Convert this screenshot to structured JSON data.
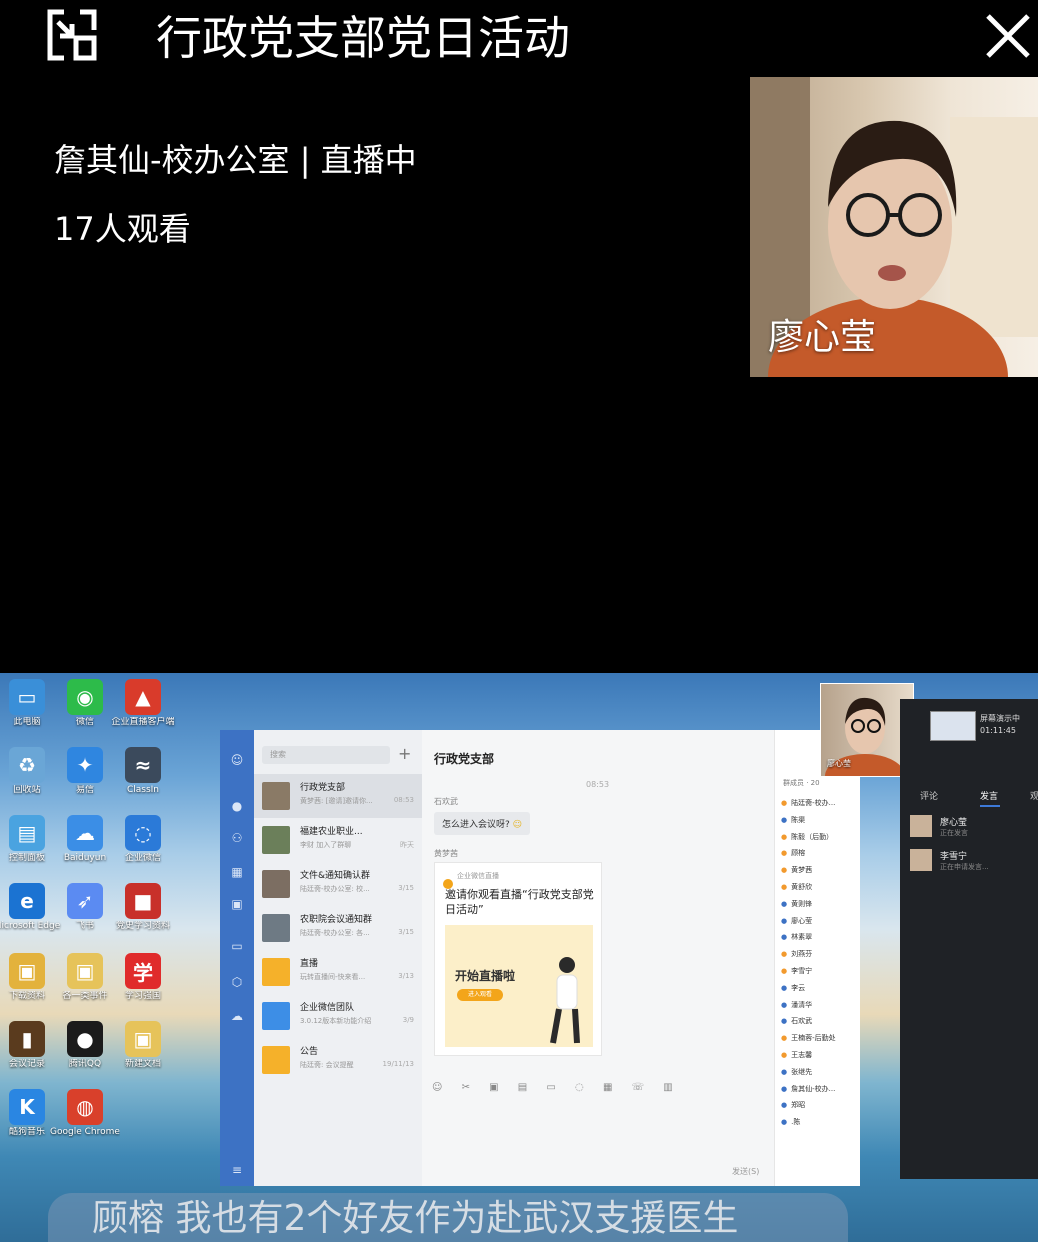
{
  "header": {
    "title": "行政党支部党日活动",
    "host_status": "詹其仙-校办公室 | 直播中",
    "viewers": "17人观看",
    "exit_fullscreen_icon": "exit-fullscreen-icon",
    "close_icon": "close-icon"
  },
  "camera": {
    "name": "廖心莹"
  },
  "desktop": {
    "icons": [
      {
        "label": "此电脑",
        "color": "#3a8fd8",
        "glyph": "▭"
      },
      {
        "label": "微信",
        "color": "#2dbb4a",
        "glyph": "◉"
      },
      {
        "label": "企业直播客户端",
        "color": "#d93b2b",
        "glyph": "▲"
      },
      {
        "label": "回收站",
        "color": "#6aa6d6",
        "glyph": "♻"
      },
      {
        "label": "易信",
        "color": "#2f86e0",
        "glyph": "✦"
      },
      {
        "label": "ClassIn",
        "color": "#3b4a5c",
        "glyph": "≈"
      },
      {
        "label": "控制面板",
        "color": "#4aa3e0",
        "glyph": "▤"
      },
      {
        "label": "Baiduyun",
        "color": "#3b8ee6",
        "glyph": "☁"
      },
      {
        "label": "企业微信",
        "color": "#2b7ad8",
        "glyph": "◌"
      },
      {
        "label": "Microsoft Edge",
        "color": "#1b73d2",
        "glyph": "e"
      },
      {
        "label": "飞书",
        "color": "#5b8bf2",
        "glyph": "➶"
      },
      {
        "label": "党史学习资料",
        "color": "#c8302a",
        "glyph": "■"
      },
      {
        "label": "下载资料",
        "color": "#e3b23c",
        "glyph": "▣"
      },
      {
        "label": "各一类事件",
        "color": "#e6c35a",
        "glyph": "▣"
      },
      {
        "label": "学习强国",
        "color": "#e02b2b",
        "glyph": "学"
      },
      {
        "label": "会议记录",
        "color": "#5a3b1e",
        "glyph": "▮"
      },
      {
        "label": "腾讯QQ",
        "color": "#1b1b1b",
        "glyph": "●"
      },
      {
        "label": "新建文档",
        "color": "#e6c35a",
        "glyph": "▣"
      },
      {
        "label": "酷狗音乐",
        "color": "#2a86e2",
        "glyph": "K"
      },
      {
        "label": "Google Chrome",
        "color": "#d9402b",
        "glyph": "◍"
      }
    ]
  },
  "wechat": {
    "search_placeholder": "搜索",
    "conversations": [
      {
        "name": "行政党支部",
        "preview": "黄梦茜: [邀请]邀请你...",
        "time": "08:53",
        "color": "#8a7a66",
        "selected": true
      },
      {
        "name": "福建农业职业...",
        "preview": "李财 加入了群聊",
        "time": "昨天",
        "color": "#6b7f5a",
        "selected": false
      },
      {
        "name": "文件&通知确认群",
        "preview": "陆廷斋-校办公室: 校...",
        "time": "3/15",
        "color": "#7c6e62",
        "selected": false
      },
      {
        "name": "农职院会议通知群",
        "preview": "陆廷斋-校办公室: 各...",
        "time": "3/15",
        "color": "#6e7a84",
        "selected": false
      },
      {
        "name": "直播",
        "preview": "玩转直播间-快来看...",
        "time": "3/13",
        "color": "#f5b12a",
        "selected": false
      },
      {
        "name": "企业微信团队",
        "preview": "3.0.12版本新功能介绍",
        "time": "3/9",
        "color": "#3d8ee6",
        "selected": false
      },
      {
        "name": "公告",
        "preview": "陆廷斋: 会议提醒",
        "time": "19/11/13",
        "color": "#f5b12a",
        "selected": false
      }
    ],
    "chat_title": "行政党支部",
    "chat_time": "08:53",
    "msg1_sender": "石欢武",
    "msg1_text": "怎么进入会议呀?",
    "msg2_sender": "黄梦茜",
    "card_source": "企业微信直播",
    "card_title": "邀请你观看直播“行政党支部党日活动”",
    "card_image_text": "开始直播啦",
    "card_button": "进入观看",
    "send_label": "发送(S)",
    "member_count": "群成员 · 20",
    "members": [
      {
        "name": "陆廷斋-校办...",
        "o": true
      },
      {
        "name": "陈渠",
        "o": false
      },
      {
        "name": "陈毅（后勤）",
        "o": true
      },
      {
        "name": "顾榕",
        "o": true
      },
      {
        "name": "黄梦茜",
        "o": true
      },
      {
        "name": "黄舒欣",
        "o": true
      },
      {
        "name": "黄则锋",
        "o": false
      },
      {
        "name": "廖心莹",
        "o": false
      },
      {
        "name": "林素翠",
        "o": false
      },
      {
        "name": "刘燕芬",
        "o": true
      },
      {
        "name": "李雪宁",
        "o": true
      },
      {
        "name": "李云",
        "o": false
      },
      {
        "name": "潘清华",
        "o": false
      },
      {
        "name": "石欢武",
        "o": false
      },
      {
        "name": "王楠蓉-后勤处",
        "o": true
      },
      {
        "name": "王志馨",
        "o": true
      },
      {
        "name": "张继先",
        "o": false
      },
      {
        "name": "詹其仙-校办...",
        "o": false
      },
      {
        "name": "郑昭",
        "o": false
      },
      {
        "name": ".陈",
        "o": false
      }
    ]
  },
  "presenter_mini": {
    "name": "廖心莹"
  },
  "side_panel": {
    "share_label": "屏幕演示中",
    "share_time": "01:11:45",
    "tab_comment": "评论",
    "tab_speak": "发言",
    "tab_more": "观",
    "users": [
      {
        "name": "廖心莹",
        "status": "正在发言"
      },
      {
        "name": "李雪宁",
        "status": "正在申请发言..."
      }
    ]
  },
  "subtitle": "顾榕 我也有2个好友作为赴武汉支援医生"
}
